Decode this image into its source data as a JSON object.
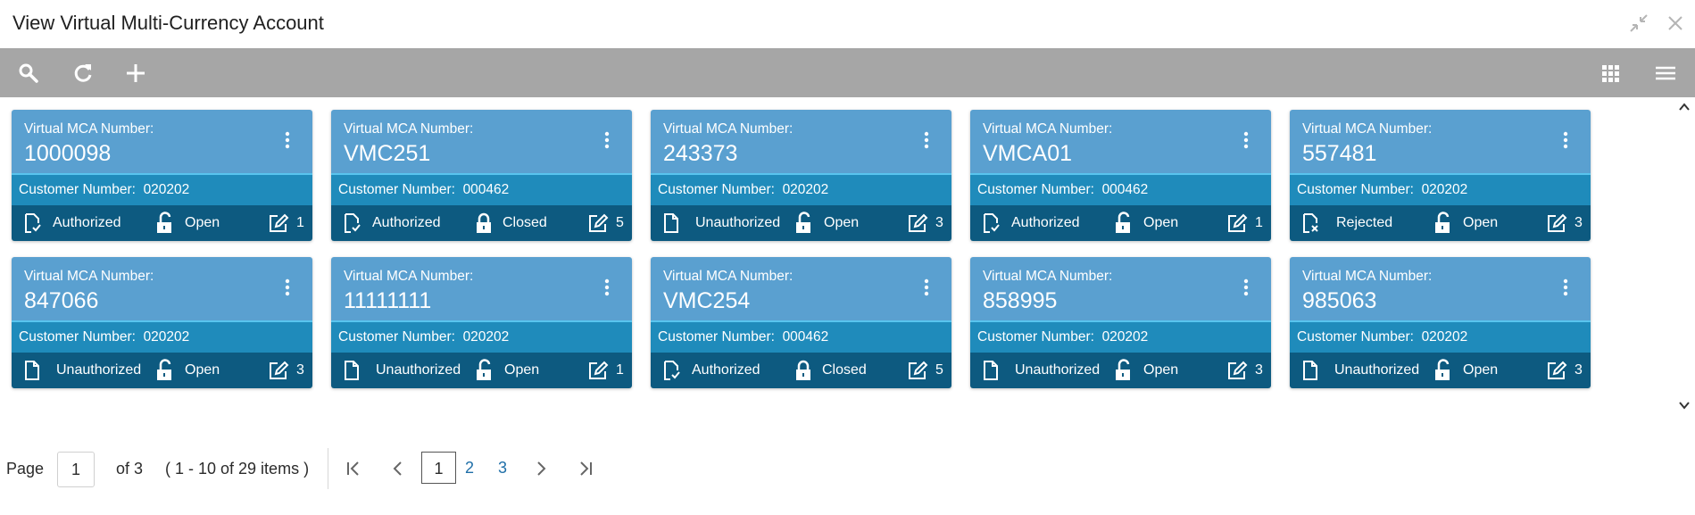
{
  "window": {
    "title": "View Virtual Multi-Currency Account"
  },
  "card_labels": {
    "account_label": "Virtual MCA Number:",
    "customer_label": "Customer Number:"
  },
  "cards": [
    {
      "number": "1000098",
      "customer": "020202",
      "auth": "Authorized",
      "status": "Open",
      "modifications": "1"
    },
    {
      "number": "VMC251",
      "customer": "000462",
      "auth": "Authorized",
      "status": "Closed",
      "modifications": "5"
    },
    {
      "number": "243373",
      "customer": "020202",
      "auth": "Unauthorized",
      "status": "Open",
      "modifications": "3"
    },
    {
      "number": "VMCA01",
      "customer": "000462",
      "auth": "Authorized",
      "status": "Open",
      "modifications": "1"
    },
    {
      "number": "557481",
      "customer": "020202",
      "auth": "Rejected",
      "status": "Open",
      "modifications": "3"
    },
    {
      "number": "847066",
      "customer": "020202",
      "auth": "Unauthorized",
      "status": "Open",
      "modifications": "3"
    },
    {
      "number": "11111111",
      "customer": "020202",
      "auth": "Unauthorized",
      "status": "Open",
      "modifications": "1"
    },
    {
      "number": "VMC254",
      "customer": "000462",
      "auth": "Authorized",
      "status": "Closed",
      "modifications": "5"
    },
    {
      "number": "858995",
      "customer": "020202",
      "auth": "Unauthorized",
      "status": "Open",
      "modifications": "3"
    },
    {
      "number": "985063",
      "customer": "020202",
      "auth": "Unauthorized",
      "status": "Open",
      "modifications": "3"
    }
  ],
  "pagination": {
    "page_label": "Page",
    "current_page": "1",
    "of_label": "of 3",
    "items_summary": "( 1 - 10 of 29 items )",
    "pages": [
      "1",
      "2",
      "3"
    ]
  },
  "colors": {
    "toolbar": "#a6a6a6",
    "card_head": "#5aa0d0",
    "card_customer": "#1f8bbb",
    "card_footer": "#0d5a80",
    "link": "#1f6fa8"
  }
}
